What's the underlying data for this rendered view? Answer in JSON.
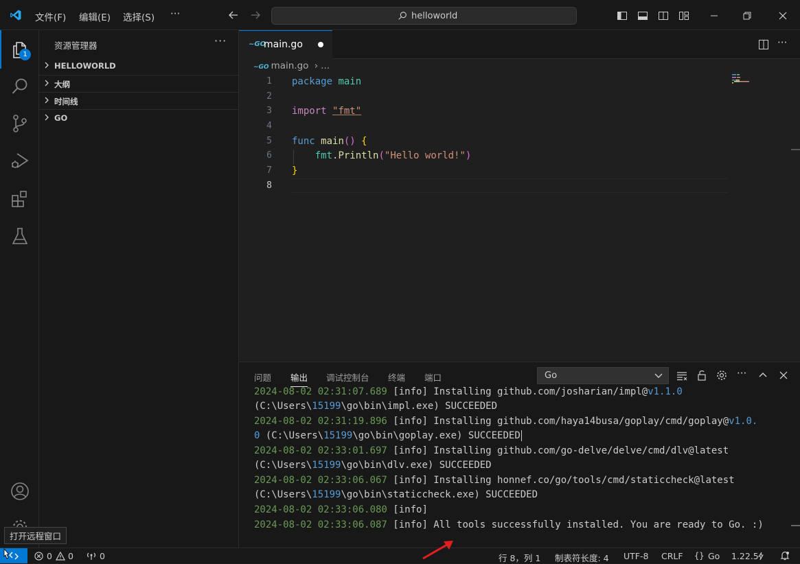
{
  "titlebar": {
    "menus": [
      "文件(F)",
      "编辑(E)",
      "选择(S)"
    ],
    "more": "···",
    "search_label": "helloworld"
  },
  "activity": {
    "explorer_badge": "1"
  },
  "sidebar": {
    "title": "资源管理器",
    "more": "···",
    "sections": [
      "HELLOWORLD",
      "大纲",
      "时间线",
      "GO"
    ]
  },
  "editor": {
    "tab": {
      "icon": "go-file-icon",
      "name": "main.go"
    },
    "breadcrumb": {
      "file": "main.go",
      "rest": "..."
    },
    "line_numbers": [
      "1",
      "2",
      "3",
      "4",
      "5",
      "6",
      "7",
      "8"
    ],
    "lines": {
      "l1": {
        "kw": "package",
        "name": "main"
      },
      "l3": {
        "kw": "import",
        "str": "\"fmt\""
      },
      "l5": {
        "kw": "func",
        "fn": "main",
        "parens": "()",
        "brace": "{"
      },
      "l6": {
        "pkg": "fmt",
        "dot": ".",
        "fn": "Println",
        "open": "(",
        "str": "\"Hello world!\"",
        "close": ")"
      },
      "l7": {
        "brace": "}"
      }
    }
  },
  "panel": {
    "tabs": [
      "问题",
      "输出",
      "调试控制台",
      "终端",
      "端口"
    ],
    "active_tab": "输出",
    "channel": "Go",
    "output": [
      {
        "ts": "2024-08-02 02:31:07.689",
        "text": " [info] Installing github.com/josharian/impl@",
        "ver": "v1.1.0"
      },
      {
        "ts": "",
        "text": "(C:\\Users\\",
        "num": "15199",
        "text2": "\\go\\bin\\impl.exe) SUCCEEDED"
      },
      {
        "ts": "2024-08-02 02:31:19.896",
        "text": " [info] Installing github.com/haya14busa/goplay/cmd/goplay@",
        "ver": "v1.0."
      },
      {
        "ts": "",
        "verstart": "0",
        "text": " (C:\\Users\\",
        "num": "15199",
        "text2": "\\go\\bin\\goplay.exe) SUCCEEDED"
      },
      {
        "ts": "2024-08-02 02:33:01.697",
        "text": " [info] Installing github.com/go-delve/delve/cmd/dlv@latest"
      },
      {
        "ts": "",
        "text": "(C:\\Users\\",
        "num": "15199",
        "text2": "\\go\\bin\\dlv.exe) SUCCEEDED"
      },
      {
        "ts": "2024-08-02 02:33:06.067",
        "text": " [info] Installing honnef.co/go/tools/cmd/staticcheck@latest"
      },
      {
        "ts": "",
        "text": "(C:\\Users\\",
        "num": "15199",
        "text2": "\\go\\bin\\staticcheck.exe) SUCCEEDED"
      },
      {
        "ts": "2024-08-02 02:33:06.080",
        "text": " [info]"
      },
      {
        "ts": "2024-08-02 02:33:06.087",
        "text": " [info] All tools successfully installed. You are ready to Go. :)"
      }
    ]
  },
  "statusbar": {
    "errors": "0",
    "warnings": "0",
    "ports": "0",
    "position": "行 8，列 1",
    "tab_size": "制表符长度: 4",
    "encoding": "UTF-8",
    "eol": "CRLF",
    "language": "Go",
    "go_version": "1.22.5"
  },
  "tooltip": "打开远程窗口",
  "colors": {
    "accent": "#0078d4",
    "background": "#1f1f1f",
    "chrome": "#181818"
  }
}
